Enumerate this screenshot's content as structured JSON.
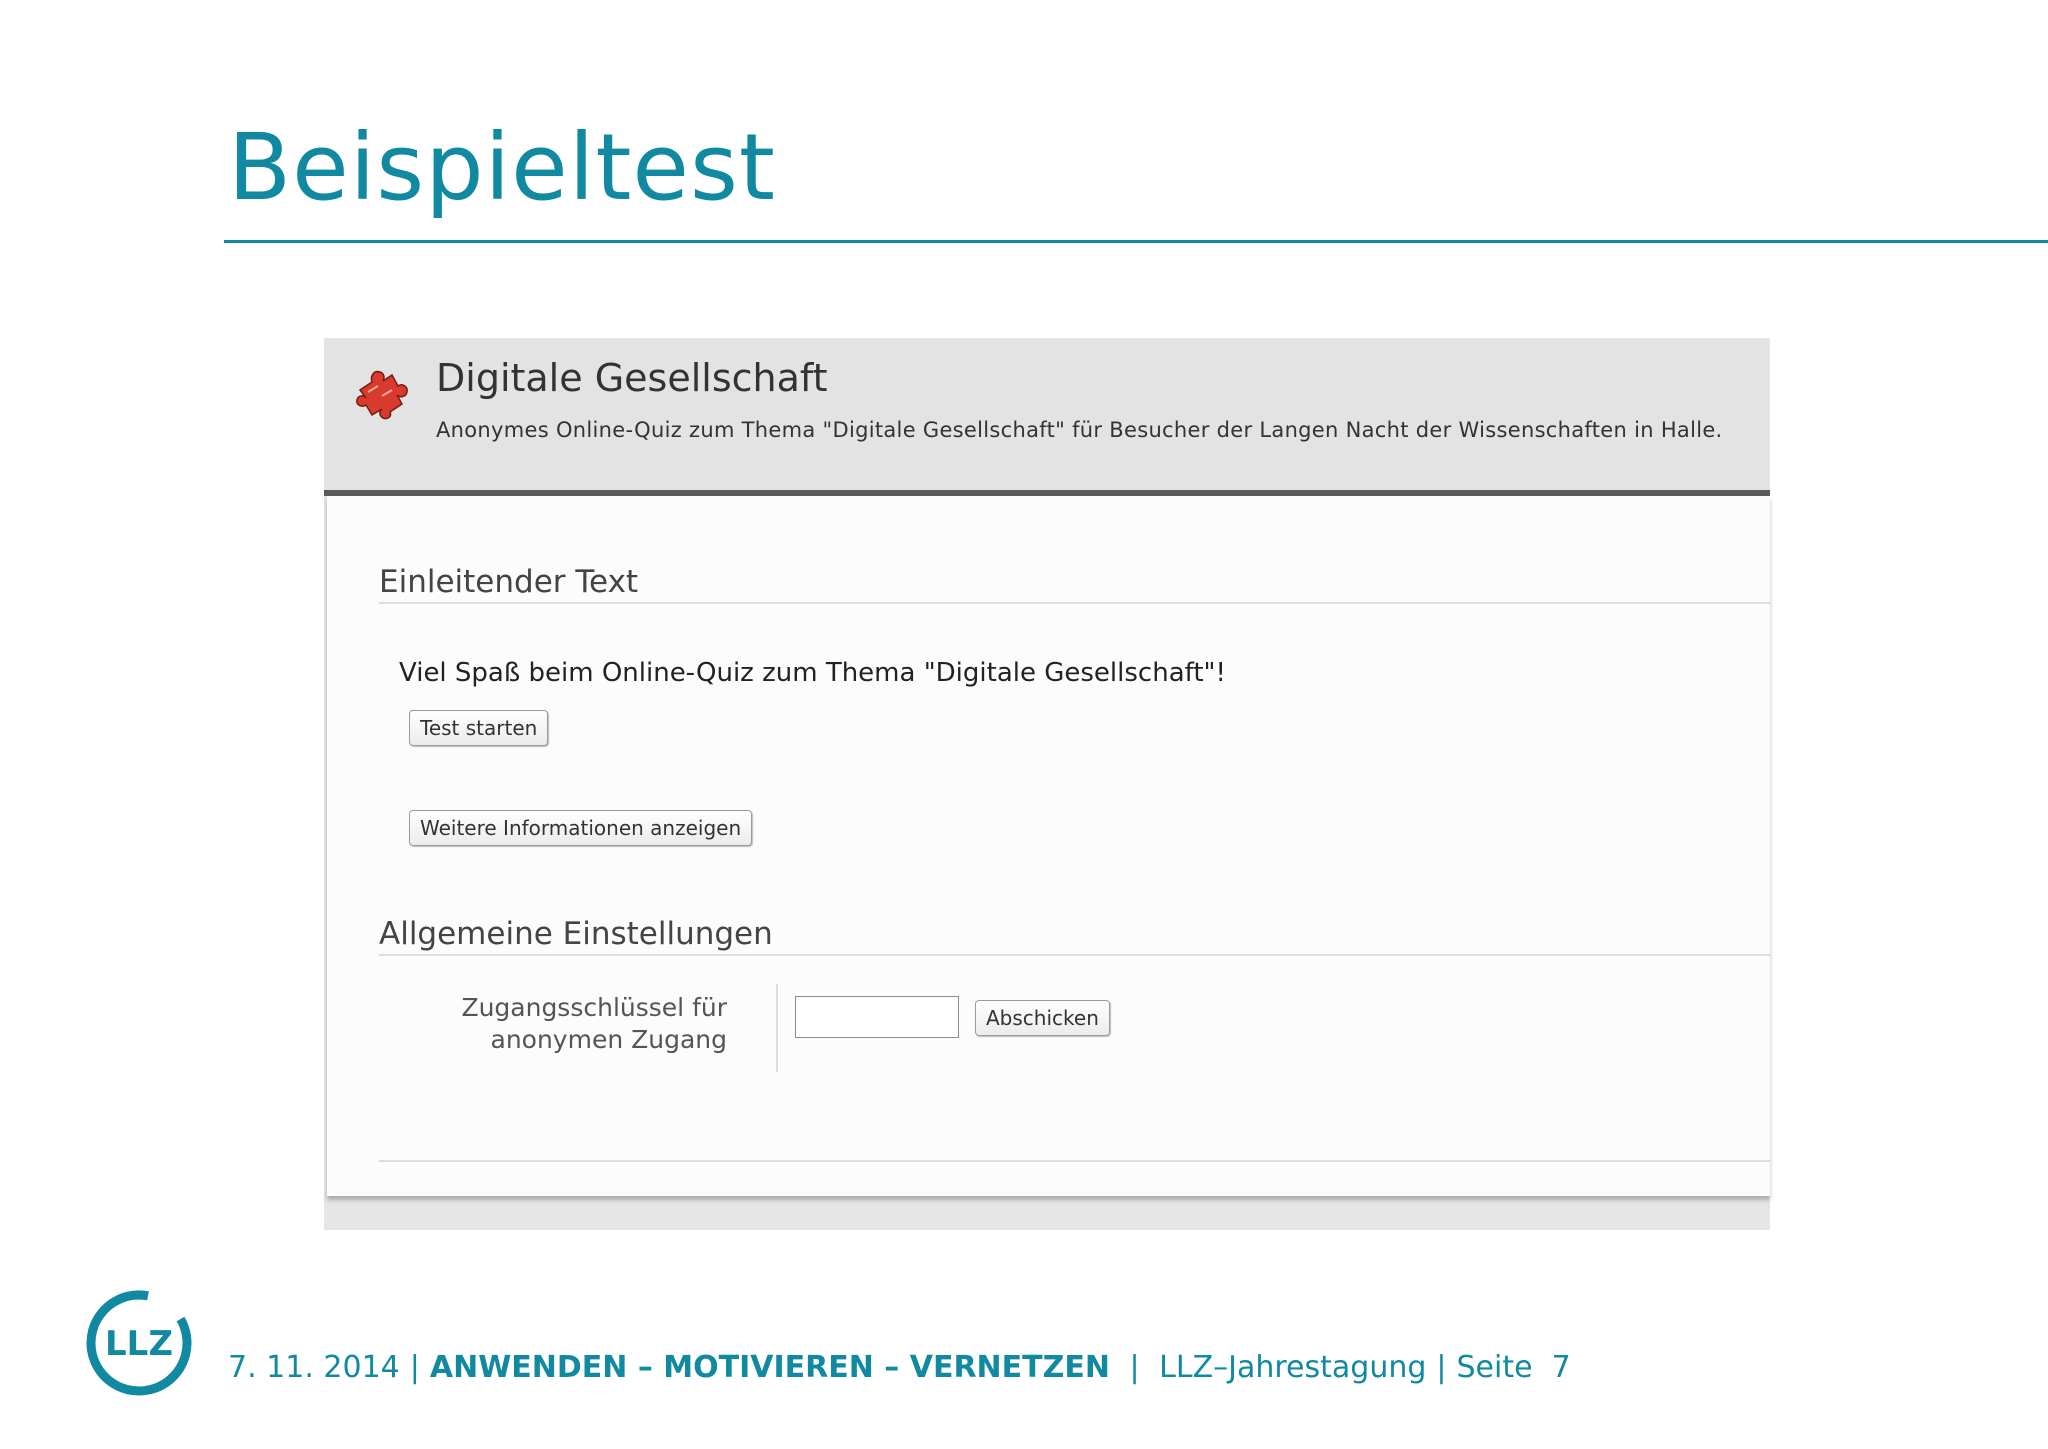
{
  "slide": {
    "title": "Beispieltest",
    "colors": {
      "accent": "#1189a0",
      "header_bg": "#e3e3e3",
      "header_bar": "#5a5a5a",
      "puzzle": "#d83a2e"
    }
  },
  "app": {
    "icon": "puzzle-piece-icon",
    "title": "Digitale Gesellschaft",
    "description": "Anonymes Online-Quiz zum Thema \"Digitale Gesellschaft\" für Besucher der Langen Nacht der Wissenschaften in Halle."
  },
  "intro": {
    "heading": "Einleitender Text",
    "text": "Viel Spaß beim Online-Quiz zum Thema \"Digitale Gesellschaft\"!",
    "start_button": "Test starten",
    "info_button": "Weitere Informationen anzeigen"
  },
  "settings": {
    "heading": "Allgemeine Einstellungen",
    "label_line1": "Zugangsschlüssel für",
    "label_line2": "anonymen Zugang",
    "input_value": "",
    "submit_button": "Abschicken"
  },
  "footer": {
    "logo_text": "LLZ",
    "date": "7. 11. 2014",
    "motto": "ANWENDEN – MOTIVIEREN – VERNETZEN",
    "event": "LLZ–Jahrestagung",
    "page_label": "Seite",
    "page_number": "7"
  }
}
